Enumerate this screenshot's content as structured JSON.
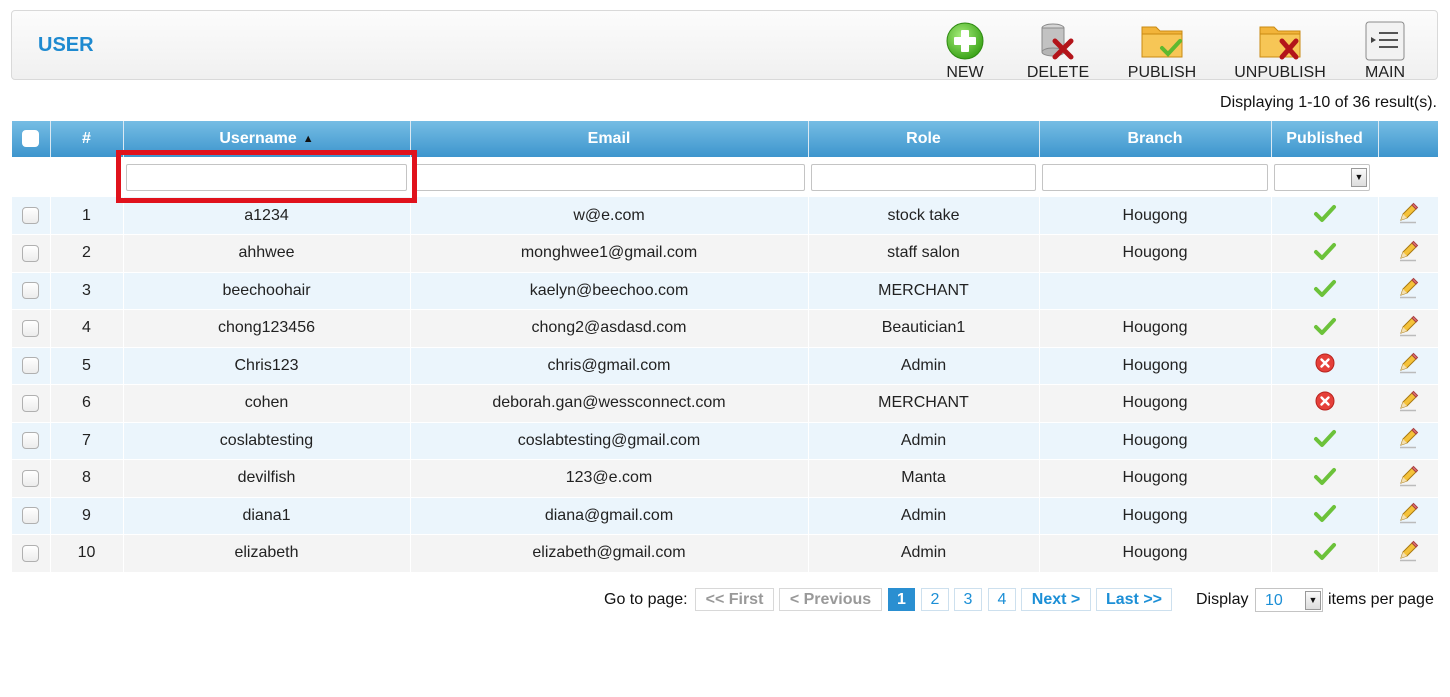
{
  "header": {
    "title": "USER"
  },
  "toolbar": [
    {
      "key": "new",
      "label": "NEW",
      "icon": "add-icon"
    },
    {
      "key": "delete",
      "label": "DELETE",
      "icon": "delete-icon"
    },
    {
      "key": "publish",
      "label": "PUBLISH",
      "icon": "publish-folder-icon"
    },
    {
      "key": "unpublish",
      "label": "UNPUBLISH",
      "icon": "unpublish-folder-icon"
    },
    {
      "key": "main",
      "label": "MAIN",
      "icon": "main-menu-icon"
    }
  ],
  "summary": "Displaying 1-10 of 36 result(s).",
  "table": {
    "columns": [
      "",
      "#",
      "Username",
      "Email",
      "Role",
      "Branch",
      "Published",
      ""
    ],
    "sorted_column": "Username",
    "sort_direction": "ascending",
    "filters": {
      "username": "",
      "email": "",
      "role": "",
      "branch": "",
      "published": ""
    },
    "rows": [
      {
        "num": "1",
        "username": "a1234",
        "email": "w@e.com",
        "role": "stock take",
        "branch": "Hougong",
        "published": true
      },
      {
        "num": "2",
        "username": "ahhwee",
        "email": "monghwee1@gmail.com",
        "role": "staff salon",
        "branch": "Hougong",
        "published": true
      },
      {
        "num": "3",
        "username": "beechoohair",
        "email": "kaelyn@beechoo.com",
        "role": "MERCHANT",
        "branch": "",
        "published": true
      },
      {
        "num": "4",
        "username": "chong123456",
        "email": "chong2@asdasd.com",
        "role": "Beautician1",
        "branch": "Hougong",
        "published": true
      },
      {
        "num": "5",
        "username": "Chris123",
        "email": "chris@gmail.com",
        "role": "Admin",
        "branch": "Hougong",
        "published": false
      },
      {
        "num": "6",
        "username": "cohen",
        "email": "deborah.gan@wessconnect.com",
        "role": "MERCHANT",
        "branch": "Hougong",
        "published": false
      },
      {
        "num": "7",
        "username": "coslabtesting",
        "email": "coslabtesting@gmail.com",
        "role": "Admin",
        "branch": "Hougong",
        "published": true
      },
      {
        "num": "8",
        "username": "devilfish",
        "email": "123@e.com",
        "role": "Manta",
        "branch": "Hougong",
        "published": true
      },
      {
        "num": "9",
        "username": "diana1",
        "email": "diana@gmail.com",
        "role": "Admin",
        "branch": "Hougong",
        "published": true
      },
      {
        "num": "10",
        "username": "elizabeth",
        "email": "elizabeth@gmail.com",
        "role": "Admin",
        "branch": "Hougong",
        "published": true
      }
    ]
  },
  "pagination": {
    "goto_label": "Go to page:",
    "first": "<< First",
    "previous": "< Previous",
    "pages": [
      "1",
      "2",
      "3",
      "4"
    ],
    "current_page": "1",
    "next": "Next >",
    "last": "Last >>",
    "display_label": "Display",
    "per_page": "10",
    "items_label": "items per page"
  },
  "colors": {
    "accent": "#1e8ad0",
    "header_gradient_top": "#76bde4",
    "header_gradient_bottom": "#3d95cd",
    "row_odd": "#ebf5fc",
    "row_even": "#f4f4f4",
    "highlight": "#e0121c",
    "published_yes": "#6cc23a",
    "published_no": "#e5403a"
  }
}
